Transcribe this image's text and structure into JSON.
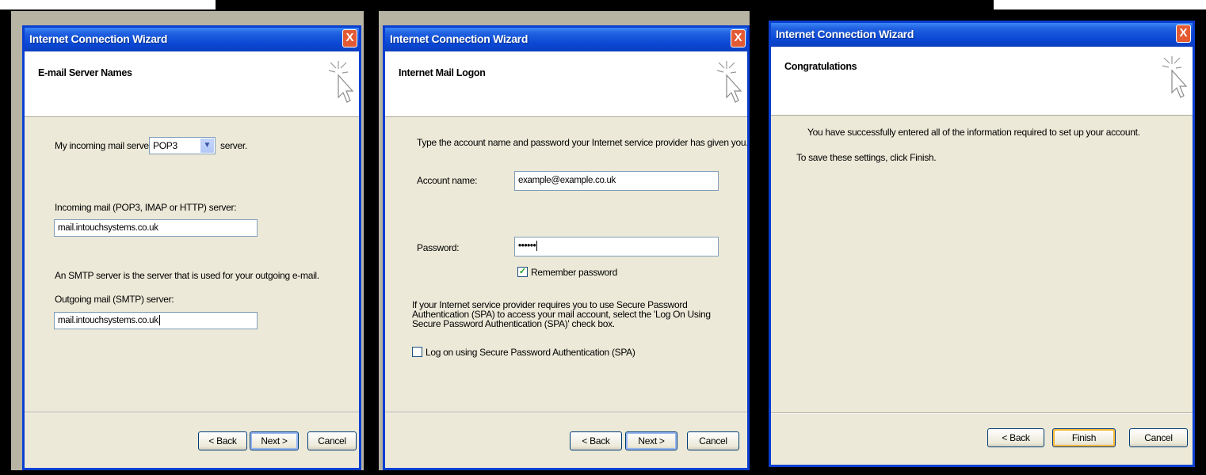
{
  "windows": [
    {
      "title": "Internet Connection Wizard",
      "close_glyph": "X",
      "page_title": "E-mail Server Names",
      "incoming_prefix": "My incoming mail server is a",
      "server_type": "POP3",
      "incoming_suffix": "server.",
      "incoming_label": "Incoming mail (POP3, IMAP or HTTP) server:",
      "incoming_value": "mail.intouchsystems.co.uk",
      "smtp_info": "An SMTP server is the server that is used for your outgoing e-mail.",
      "outgoing_label": "Outgoing mail (SMTP) server:",
      "outgoing_value": "mail.intouchsystems.co.uk",
      "back": "< Back",
      "next": "Next >",
      "cancel": "Cancel"
    },
    {
      "title": "Internet Connection Wizard",
      "close_glyph": "X",
      "page_title": "Internet Mail Logon",
      "intro": "Type the account name and password your Internet service provider has given you.",
      "account_label": "Account name:",
      "account_value": "example@example.co.uk",
      "password_label": "Password:",
      "password_value": "••••••",
      "remember_label": "Remember password",
      "remember_checked": true,
      "spa_info": "If your Internet service provider requires you to use Secure Password Authentication (SPA) to access your mail account, select the 'Log On Using Secure Password Authentication (SPA)' check box.",
      "spa_label": "Log on using Secure Password Authentication (SPA)",
      "spa_checked": false,
      "back": "< Back",
      "next": "Next >",
      "cancel": "Cancel"
    },
    {
      "title": "Internet Connection Wizard",
      "close_glyph": "X",
      "page_title": "Congratulations",
      "message1": "You have successfully entered all of the information required to set up your account.",
      "message2": "To save these settings, click Finish.",
      "back": "< Back",
      "finish": "Finish",
      "cancel": "Cancel"
    }
  ],
  "colors": {
    "title_bar": "#0a47d4",
    "close_button": "#e35a33",
    "dialog_face": "#ece9d8",
    "background": "#000000"
  }
}
